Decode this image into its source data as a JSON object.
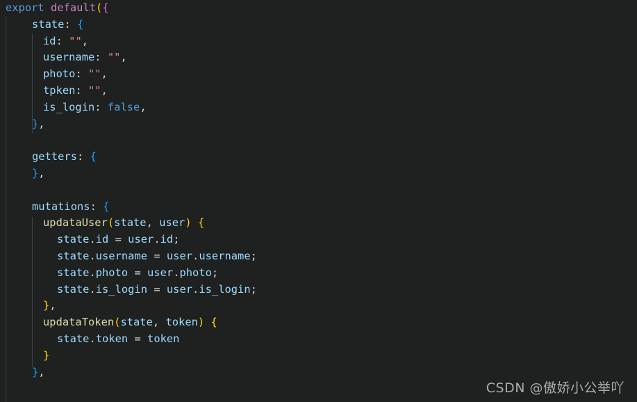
{
  "editor": {
    "language": "javascript",
    "theme": "dark-plus",
    "background_color": "#1f2020",
    "font_size_px": 15,
    "line_height_px": 24,
    "indent_guide_color": "#404040"
  },
  "watermark": {
    "text": "CSDN @傲娇小公举吖",
    "color": "#b9b9b9"
  },
  "colors": {
    "keyword": "#569cd6",
    "control": "#c586c0",
    "property": "#9cdcfe",
    "variable": "#9cdcfe",
    "string": "#ce9178",
    "function": "#dcdcaa",
    "plain": "#d4d4d4",
    "bracket_yellow": "#ffd700",
    "bracket_pink": "#da70d6",
    "bracket_blue": "#179fff"
  },
  "code": {
    "full_text": "export default({\n    state: {\n      id: \"\",\n      username: \"\",\n      photo: \"\",\n      tpken: \"\",\n      is_login: false,\n    },\n\n    getters: {\n    },\n\n    mutations: {\n      updataUser(state, user) {\n        state.id = user.id;\n        state.username = user.username;\n        state.photo = user.photo;\n        state.is_login = user.is_login;\n      },\n      updataToken(state, token) {\n        state.token = token\n      }\n    },",
    "lines": [
      {
        "n": 1,
        "indent": 0,
        "text": "export default({"
      },
      {
        "n": 2,
        "indent": 1,
        "text": "state: {"
      },
      {
        "n": 3,
        "indent": 2,
        "text": "id: \"\","
      },
      {
        "n": 4,
        "indent": 2,
        "text": "username: \"\","
      },
      {
        "n": 5,
        "indent": 2,
        "text": "photo: \"\","
      },
      {
        "n": 6,
        "indent": 2,
        "text": "tpken: \"\","
      },
      {
        "n": 7,
        "indent": 2,
        "text": "is_login: false,"
      },
      {
        "n": 8,
        "indent": 1,
        "text": "},"
      },
      {
        "n": 9,
        "indent": 0,
        "text": ""
      },
      {
        "n": 10,
        "indent": 1,
        "text": "getters: {"
      },
      {
        "n": 11,
        "indent": 1,
        "text": "},"
      },
      {
        "n": 12,
        "indent": 0,
        "text": ""
      },
      {
        "n": 13,
        "indent": 1,
        "text": "mutations: {"
      },
      {
        "n": 14,
        "indent": 2,
        "text": "updataUser(state, user) {"
      },
      {
        "n": 15,
        "indent": 3,
        "text": "state.id = user.id;"
      },
      {
        "n": 16,
        "indent": 3,
        "text": "state.username = user.username;"
      },
      {
        "n": 17,
        "indent": 3,
        "text": "state.photo = user.photo;"
      },
      {
        "n": 18,
        "indent": 3,
        "text": "state.is_login = user.is_login;"
      },
      {
        "n": 19,
        "indent": 2,
        "text": "},"
      },
      {
        "n": 20,
        "indent": 2,
        "text": "updataToken(state, token) {"
      },
      {
        "n": 21,
        "indent": 3,
        "text": "state.token = token"
      },
      {
        "n": 22,
        "indent": 2,
        "text": "}"
      },
      {
        "n": 23,
        "indent": 1,
        "text": "},"
      }
    ],
    "tokens": {
      "l1": {
        "kw": "export",
        "sp1": " ",
        "ctrl": "default",
        "paren": "(",
        "brace": "{"
      },
      "l2": {
        "prop": "state",
        "colon": ": ",
        "brace": "{"
      },
      "l3": {
        "prop": "id",
        "colon": ": ",
        "str": "\"\"",
        "comma": ","
      },
      "l4": {
        "prop": "username",
        "colon": ": ",
        "str": "\"\"",
        "comma": ","
      },
      "l5": {
        "prop": "photo",
        "colon": ": ",
        "str": "\"\"",
        "comma": ","
      },
      "l6": {
        "prop": "tpken",
        "colon": ": ",
        "str": "\"\"",
        "comma": ","
      },
      "l7": {
        "prop": "is_login",
        "colon": ": ",
        "kw": "false",
        "comma": ","
      },
      "l8": {
        "brace": "}",
        "comma": ","
      },
      "l10": {
        "prop": "getters",
        "colon": ": ",
        "brace": "{"
      },
      "l11": {
        "brace": "}",
        "comma": ","
      },
      "l13": {
        "prop": "mutations",
        "colon": ": ",
        "brace": "{"
      },
      "l14": {
        "fn": "updataUser",
        "open": "(",
        "a1": "state",
        "sep": ", ",
        "a2": "user",
        "close": ")",
        "sp": " ",
        "brace": "{"
      },
      "l15": {
        "obj": "state",
        "dot1": ".",
        "p1": "id",
        "eq": " = ",
        "obj2": "user",
        "dot2": ".",
        "p2": "id",
        "semi": ";"
      },
      "l16": {
        "obj": "state",
        "dot1": ".",
        "p1": "username",
        "eq": " = ",
        "obj2": "user",
        "dot2": ".",
        "p2": "username",
        "semi": ";"
      },
      "l17": {
        "obj": "state",
        "dot1": ".",
        "p1": "photo",
        "eq": " = ",
        "obj2": "user",
        "dot2": ".",
        "p2": "photo",
        "semi": ";"
      },
      "l18": {
        "obj": "state",
        "dot1": ".",
        "p1": "is_login",
        "eq": " = ",
        "obj2": "user",
        "dot2": ".",
        "p2": "is_login",
        "semi": ";"
      },
      "l19": {
        "brace": "}",
        "comma": ","
      },
      "l20": {
        "fn": "updataToken",
        "open": "(",
        "a1": "state",
        "sep": ", ",
        "a2": "token",
        "close": ")",
        "sp": " ",
        "brace": "{"
      },
      "l21": {
        "obj": "state",
        "dot1": ".",
        "p1": "token",
        "eq": " = ",
        "val": "token"
      },
      "l22": {
        "brace": "}"
      },
      "l23": {
        "brace": "}",
        "comma": ","
      }
    }
  }
}
